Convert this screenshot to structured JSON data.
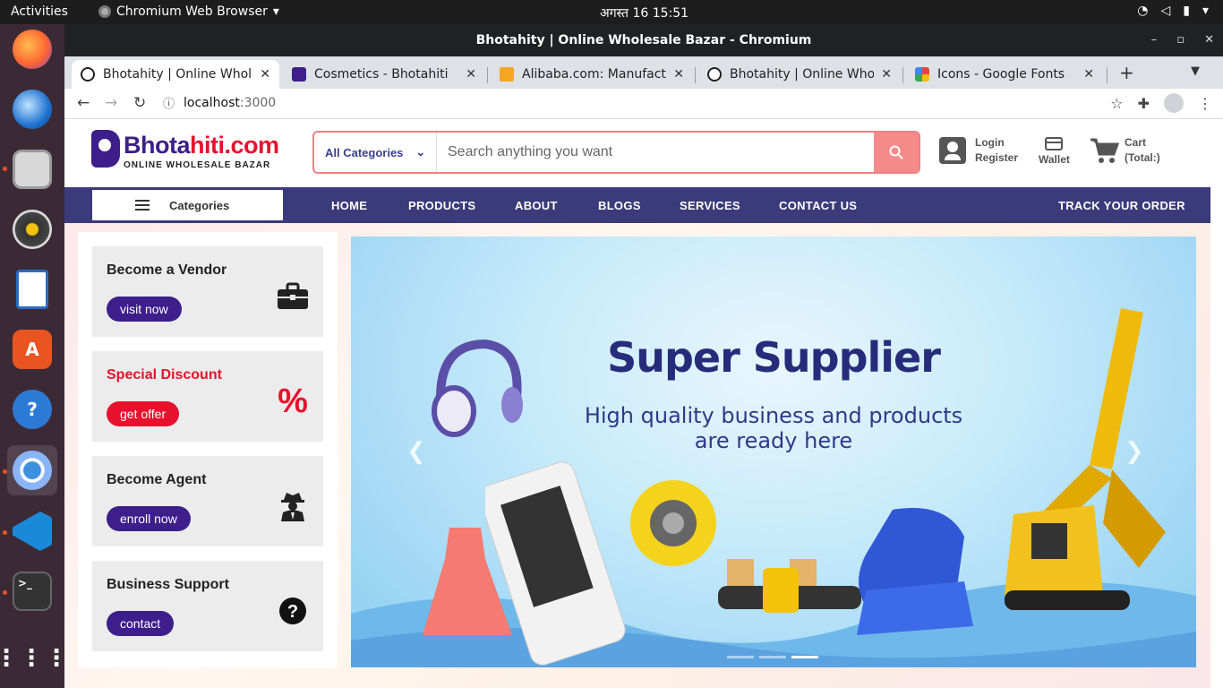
{
  "os": {
    "activities": "Activities",
    "app_name": "Chromium Web Browser",
    "clock": "अगस्त 16  15:51"
  },
  "window": {
    "title": "Bhotahity | Online Wholesale Bazar - Chromium"
  },
  "tabs": [
    {
      "title": "Bhotahity | Online Whole",
      "fav_color": "#222222"
    },
    {
      "title": "Cosmetics - Bhotahiti",
      "fav_color": "#3d1e8a"
    },
    {
      "title": "Alibaba.com: Manufactu",
      "fav_color": "#f5a623"
    },
    {
      "title": "Bhotahity | Online Whole",
      "fav_color": "#222222"
    },
    {
      "title": "Icons - Google Fonts",
      "fav_color": "#4285f4"
    }
  ],
  "address": {
    "host": "localhost",
    "port": ":3000"
  },
  "site": {
    "logo_text_1": "Bhota",
    "logo_text_2": "hiti.com",
    "logo_tagline": "ONLINE WHOLESALE BAZAR",
    "search": {
      "category": "All Categories",
      "placeholder": "Search anything you want"
    },
    "login": "Login",
    "register": "Register",
    "wallet": "Wallet",
    "cart": "Cart",
    "cart_total": "(Total:)",
    "categories_button": "Categories",
    "nav": [
      "HOME",
      "PRODUCTS",
      "ABOUT",
      "BLOGS",
      "SERVICES",
      "CONTACT US"
    ],
    "track_order": "TRACK YOUR ORDER"
  },
  "cards": [
    {
      "title": "Become a Vendor",
      "button": "visit now",
      "icon": "briefcase-icon"
    },
    {
      "title": "Special Discount",
      "button": "get offer",
      "icon": "percent-icon"
    },
    {
      "title": "Become Agent",
      "button": "enroll now",
      "icon": "agent-icon"
    },
    {
      "title": "Business Support",
      "button": "contact",
      "icon": "question-icon"
    }
  ],
  "hero": {
    "headline": "Super Supplier",
    "subline_1": "High quality business and products",
    "subline_2": "are ready here",
    "slides_total": 3,
    "active_slide": 3
  },
  "colors": {
    "brand_purple": "#3d1e8a",
    "brand_red": "#e8112d",
    "navbar": "#3b3a7a"
  }
}
